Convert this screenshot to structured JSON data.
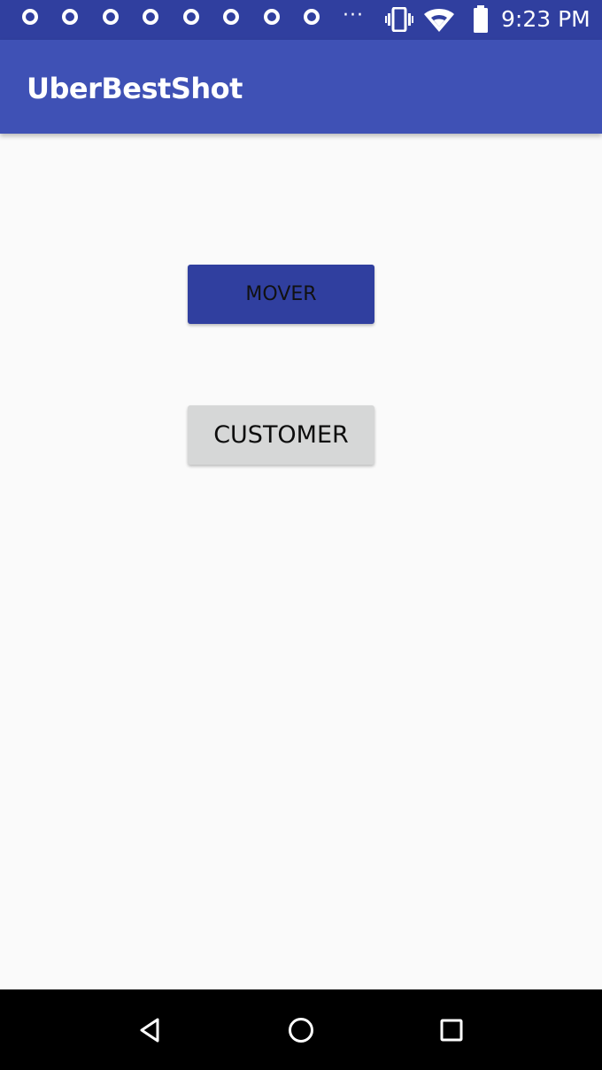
{
  "status_bar": {
    "time": "9:23 PM",
    "notification_icons": [
      "opera-icon",
      "opera-icon",
      "opera-icon",
      "opera-icon",
      "opera-icon",
      "opera-icon",
      "opera-icon",
      "opera-icon"
    ],
    "overflow": "···",
    "system_icons": [
      "vibrate-icon",
      "wifi-icon",
      "battery-icon"
    ]
  },
  "app_bar": {
    "title": "UberBestShot"
  },
  "main": {
    "mover_label": "MOVER",
    "customer_label": "CUSTOMER"
  },
  "nav_bar": {
    "buttons": [
      "back-icon",
      "home-icon",
      "recents-icon"
    ]
  },
  "colors": {
    "status_bar": "#303f9f",
    "app_bar": "#3f51b5",
    "mover_button": "#303f9f",
    "customer_button": "#d6d7d7",
    "background": "#fafafa",
    "nav_bar": "#000000"
  }
}
